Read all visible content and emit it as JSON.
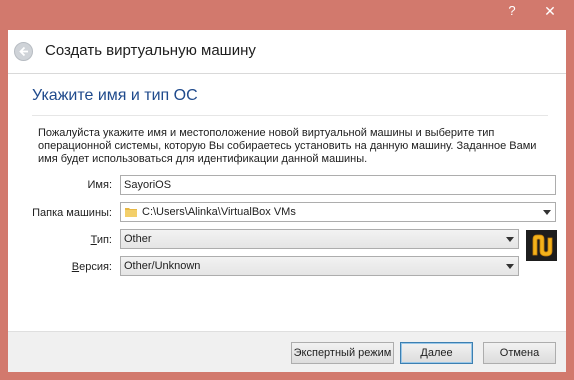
{
  "window": {
    "help_label": "?",
    "close_label": "✕"
  },
  "header": {
    "back_icon": "back-arrow-icon",
    "title": "Создать виртуальную машину"
  },
  "page": {
    "section_title": "Укажите имя и тип ОС",
    "description": "Пожалуйста укажите имя и местоположение новой виртуальной машины и выберите тип операционной системы, которую Вы собираетесь установить на данную машину. Заданное Вами имя будет использоваться для идентификации данной машины."
  },
  "form": {
    "name_label": "Имя:",
    "name_value": "SayoriOS",
    "folder_label": "Папка машины:",
    "folder_value": "C:\\Users\\Alinka\\VirtualBox VMs",
    "type_label_prefix": "Т",
    "type_label_rest": "ип:",
    "type_value": "Other",
    "version_label_prefix": "В",
    "version_label_rest": "ерсия:",
    "version_value": "Other/Unknown",
    "os_icon": "os-other-icon"
  },
  "footer": {
    "expert_label": "Экспертный режим",
    "next_label": "Далее",
    "cancel_label": "Отмена"
  },
  "colors": {
    "frame": "#d2796d",
    "section_title": "#1f4a8c",
    "default_button_border": "#3c7fb1"
  }
}
